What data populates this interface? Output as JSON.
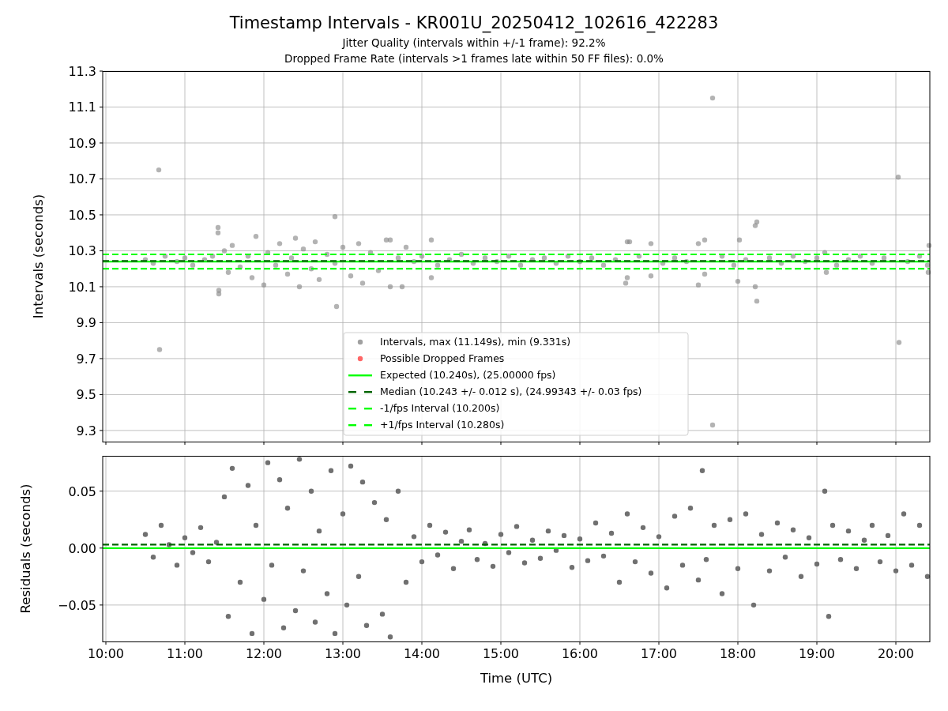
{
  "figure": {
    "title": "Timestamp Intervals - KR001U_20250412_102616_422283",
    "subtitles": [
      "Jitter Quality (intervals within +/-1 frame): 92.2%",
      "Dropped Frame Rate (intervals >1 frames late within 50 FF files): 0.0%"
    ]
  },
  "top_plot": {
    "chart_data": {
      "type": "scatter",
      "ylabel": "Intervals (seconds)",
      "xlim": [
        9.96,
        20.43
      ],
      "ylim": [
        9.238,
        11.3
      ],
      "grid": true,
      "yticks": [
        {
          "value": 9.3,
          "label": "9.3"
        },
        {
          "value": 9.5,
          "label": "9.5"
        },
        {
          "value": 9.7,
          "label": "9.7"
        },
        {
          "value": 9.9,
          "label": "9.9"
        },
        {
          "value": 10.1,
          "label": "10.1"
        },
        {
          "value": 10.3,
          "label": "10.3"
        },
        {
          "value": 10.5,
          "label": "10.5"
        },
        {
          "value": 10.7,
          "label": "10.7"
        },
        {
          "value": 10.9,
          "label": "10.9"
        },
        {
          "value": 11.1,
          "label": "11.1"
        },
        {
          "value": 11.3,
          "label": "11.3"
        }
      ],
      "x": [
        10.67,
        10.68,
        17.68,
        17.68,
        20.03,
        20.04,
        11.42,
        11.42,
        11.43,
        11.43,
        12.9,
        12.92,
        13.6,
        14.12,
        14.12,
        16.6,
        16.63,
        16.58,
        16.6,
        17.5,
        17.58,
        17.5,
        17.58,
        18.22,
        18.24,
        18.24,
        18.22,
        18.02,
        18.0,
        16.9,
        16.9,
        20.42,
        20.41,
        19.1,
        19.12,
        10.5,
        10.6,
        10.75,
        10.9,
        11.0,
        11.1,
        11.25,
        11.35,
        13.9,
        14.0,
        14.2,
        14.35,
        14.5,
        14.65,
        14.8,
        14.95,
        15.1,
        15.25,
        15.4,
        15.55,
        15.7,
        15.85,
        16.0,
        16.15,
        16.3,
        16.45,
        16.75,
        17.05,
        17.2,
        17.35,
        17.8,
        17.95,
        18.1,
        18.4,
        18.55,
        18.7,
        18.85,
        19.0,
        19.25,
        19.4,
        19.55,
        19.7,
        19.85,
        20.15,
        20.3,
        20.4,
        11.5,
        11.55,
        11.6,
        11.7,
        11.8,
        11.85,
        11.9,
        12.0,
        12.05,
        12.15,
        12.2,
        12.3,
        12.35,
        12.4,
        12.45,
        12.5,
        12.6,
        12.65,
        12.7,
        12.8,
        12.9,
        13.0,
        13.1,
        13.2,
        13.25,
        13.35,
        13.45,
        13.55,
        13.6,
        13.7,
        13.75,
        13.8
      ],
      "series": [
        {
          "color": "#808080",
          "values": [
            10.75,
            9.75,
            11.15,
            9.33,
            10.71,
            9.79,
            10.43,
            10.4,
            10.08,
            10.06,
            10.49,
            9.99,
            10.36,
            10.36,
            10.15,
            10.35,
            10.35,
            10.12,
            10.15,
            10.34,
            10.36,
            10.11,
            10.17,
            10.44,
            10.46,
            10.02,
            10.1,
            10.36,
            10.13,
            10.34,
            10.16,
            10.33,
            10.18,
            10.29,
            10.18,
            10.25,
            10.23,
            10.27,
            10.24,
            10.26,
            10.22,
            10.25,
            10.27,
            10.24,
            10.27,
            10.22,
            10.25,
            10.28,
            10.23,
            10.26,
            10.24,
            10.27,
            10.22,
            10.25,
            10.26,
            10.23,
            10.27,
            10.24,
            10.26,
            10.22,
            10.25,
            10.27,
            10.23,
            10.26,
            10.24,
            10.27,
            10.22,
            10.25,
            10.26,
            10.23,
            10.27,
            10.24,
            10.26,
            10.22,
            10.25,
            10.27,
            10.23,
            10.26,
            10.24,
            10.27,
            10.22,
            10.3,
            10.18,
            10.33,
            10.21,
            10.27,
            10.15,
            10.38,
            10.11,
            10.29,
            10.22,
            10.34,
            10.17,
            10.26,
            10.37,
            10.1,
            10.31,
            10.2,
            10.35,
            10.14,
            10.28,
            10.23,
            10.32,
            10.16,
            10.34,
            10.12,
            10.29,
            10.19,
            10.36,
            10.1,
            10.26,
            10.1,
            10.32
          ]
        }
      ],
      "ref_lines": [
        {
          "axis": "y",
          "value": 10.24,
          "color": "#00ff00"
        },
        {
          "axis": "y",
          "value": 10.243,
          "color": "#006400"
        },
        {
          "axis": "y",
          "value": 10.2,
          "color": "#00ff00"
        },
        {
          "axis": "y",
          "value": 10.28,
          "color": "#00ff00"
        }
      ]
    },
    "legend": [
      {
        "kind": "marker",
        "color": "#a0a0a0",
        "label": "Intervals, max (11.149s), min (9.331s)"
      },
      {
        "kind": "marker",
        "color": "#ff6666",
        "label": "Possible Dropped Frames"
      },
      {
        "kind": "line",
        "color": "#00ff00",
        "label": "Expected (10.240s), (25.00000 fps)"
      },
      {
        "kind": "dashed",
        "color": "#006400",
        "label": "Median (10.243 +/- 0.012 s), (24.99343 +/- 0.03 fps)"
      },
      {
        "kind": "dashed",
        "color": "#00ff00",
        "label": "-1/fps Interval (10.200s)"
      },
      {
        "kind": "dashed",
        "color": "#00ff00",
        "label": "+1/fps Interval (10.280s)"
      }
    ]
  },
  "bottom_plot": {
    "chart_data": {
      "type": "scatter",
      "xlabel": "Time (UTC)",
      "ylabel": "Residuals (seconds)",
      "xlim": [
        9.96,
        20.43
      ],
      "ylim": [
        -0.082,
        0.081
      ],
      "grid": true,
      "xticks": [
        {
          "value": 10,
          "label": "10:00"
        },
        {
          "value": 11,
          "label": "11:00"
        },
        {
          "value": 12,
          "label": "12:00"
        },
        {
          "value": 13,
          "label": "13:00"
        },
        {
          "value": 14,
          "label": "14:00"
        },
        {
          "value": 15,
          "label": "15:00"
        },
        {
          "value": 16,
          "label": "16:00"
        },
        {
          "value": 17,
          "label": "17:00"
        },
        {
          "value": 18,
          "label": "18:00"
        },
        {
          "value": 19,
          "label": "19:00"
        },
        {
          "value": 20,
          "label": "20:00"
        }
      ],
      "yticks": [
        {
          "value": -0.05,
          "label": "−0.05"
        },
        {
          "value": 0,
          "label": "0.00"
        },
        {
          "value": 0.05,
          "label": "0.05"
        }
      ],
      "x": [
        10.5,
        10.6,
        10.7,
        10.8,
        10.9,
        11.0,
        11.1,
        11.2,
        11.3,
        11.4,
        11.5,
        11.55,
        11.6,
        11.7,
        11.8,
        11.85,
        11.9,
        12.0,
        12.05,
        12.1,
        12.2,
        12.25,
        12.3,
        12.4,
        12.45,
        12.5,
        12.6,
        12.65,
        12.7,
        12.8,
        12.85,
        12.9,
        13.0,
        13.05,
        13.1,
        13.2,
        13.25,
        13.3,
        13.4,
        13.5,
        13.55,
        13.6,
        13.7,
        13.8,
        13.9,
        14.0,
        14.1,
        14.2,
        14.3,
        14.4,
        14.5,
        14.6,
        14.7,
        14.8,
        14.9,
        15.0,
        15.1,
        15.2,
        15.3,
        15.4,
        15.5,
        15.6,
        15.7,
        15.8,
        15.9,
        16.0,
        16.1,
        16.2,
        16.3,
        16.4,
        16.5,
        16.6,
        16.7,
        16.8,
        16.9,
        17.0,
        17.1,
        17.2,
        17.3,
        17.4,
        17.5,
        17.55,
        17.6,
        17.7,
        17.8,
        17.9,
        18.0,
        18.1,
        18.2,
        18.3,
        18.4,
        18.5,
        18.6,
        18.7,
        18.8,
        18.9,
        19.0,
        19.1,
        19.15,
        19.2,
        19.3,
        19.4,
        19.5,
        19.6,
        19.7,
        19.8,
        19.9,
        20.0,
        20.1,
        20.2,
        20.3,
        20.4
      ],
      "series": [
        {
          "color": "#707070",
          "values": [
            0.012,
            -0.008,
            0.02,
            0.003,
            -0.015,
            0.009,
            -0.004,
            0.018,
            -0.012,
            0.005,
            0.045,
            -0.06,
            0.07,
            -0.03,
            0.055,
            -0.075,
            0.02,
            -0.045,
            0.075,
            -0.015,
            0.06,
            -0.07,
            0.035,
            -0.055,
            0.078,
            -0.02,
            0.05,
            -0.065,
            0.015,
            -0.04,
            0.068,
            -0.075,
            0.03,
            -0.05,
            0.072,
            -0.025,
            0.058,
            -0.068,
            0.04,
            -0.058,
            0.025,
            -0.078,
            0.05,
            -0.03,
            0.01,
            -0.012,
            0.02,
            -0.006,
            0.014,
            -0.018,
            0.006,
            0.016,
            -0.01,
            0.004,
            -0.016,
            0.012,
            -0.004,
            0.019,
            -0.013,
            0.007,
            -0.009,
            0.015,
            -0.002,
            0.011,
            -0.017,
            0.008,
            -0.011,
            0.022,
            -0.007,
            0.013,
            -0.03,
            0.03,
            -0.012,
            0.018,
            -0.022,
            0.01,
            -0.035,
            0.028,
            -0.015,
            0.035,
            -0.028,
            0.068,
            -0.01,
            0.02,
            -0.04,
            0.025,
            -0.018,
            0.03,
            -0.05,
            0.012,
            -0.02,
            0.022,
            -0.008,
            0.016,
            -0.025,
            0.009,
            -0.014,
            0.05,
            -0.06,
            0.02,
            -0.01,
            0.015,
            -0.018,
            0.007,
            0.02,
            -0.012,
            0.011,
            -0.02,
            0.03,
            -0.015,
            0.02,
            -0.025
          ]
        }
      ],
      "ref_lines": [
        {
          "axis": "y",
          "value": 0,
          "color": "#00ff00"
        },
        {
          "axis": "y",
          "value": 0.003,
          "color": "#006400"
        }
      ]
    }
  }
}
